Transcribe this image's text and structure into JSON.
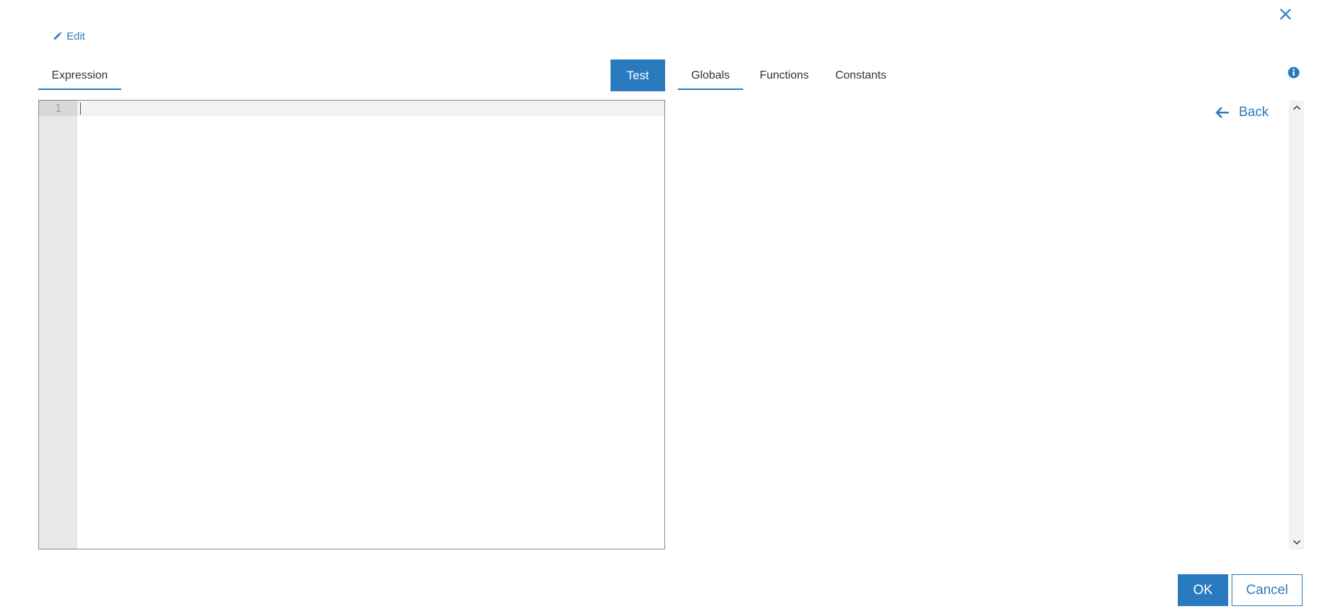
{
  "dialog": {
    "edit_label": "Edit",
    "close_icon": "close-icon"
  },
  "left": {
    "tabs": [
      {
        "label": "Expression",
        "active": true
      }
    ],
    "test_label": "Test",
    "editor": {
      "line_numbers": [
        "1"
      ],
      "content": ""
    }
  },
  "right": {
    "tabs": [
      {
        "label": "Globals",
        "active": true
      },
      {
        "label": "Functions",
        "active": false
      },
      {
        "label": "Constants",
        "active": false
      }
    ],
    "back_label": "Back",
    "info_icon": "info-icon"
  },
  "footer": {
    "ok_label": "OK",
    "cancel_label": "Cancel"
  },
  "colors": {
    "accent": "#2a7abf",
    "gutter": "#e8e8e8",
    "active_line": "#f2f2f2"
  }
}
